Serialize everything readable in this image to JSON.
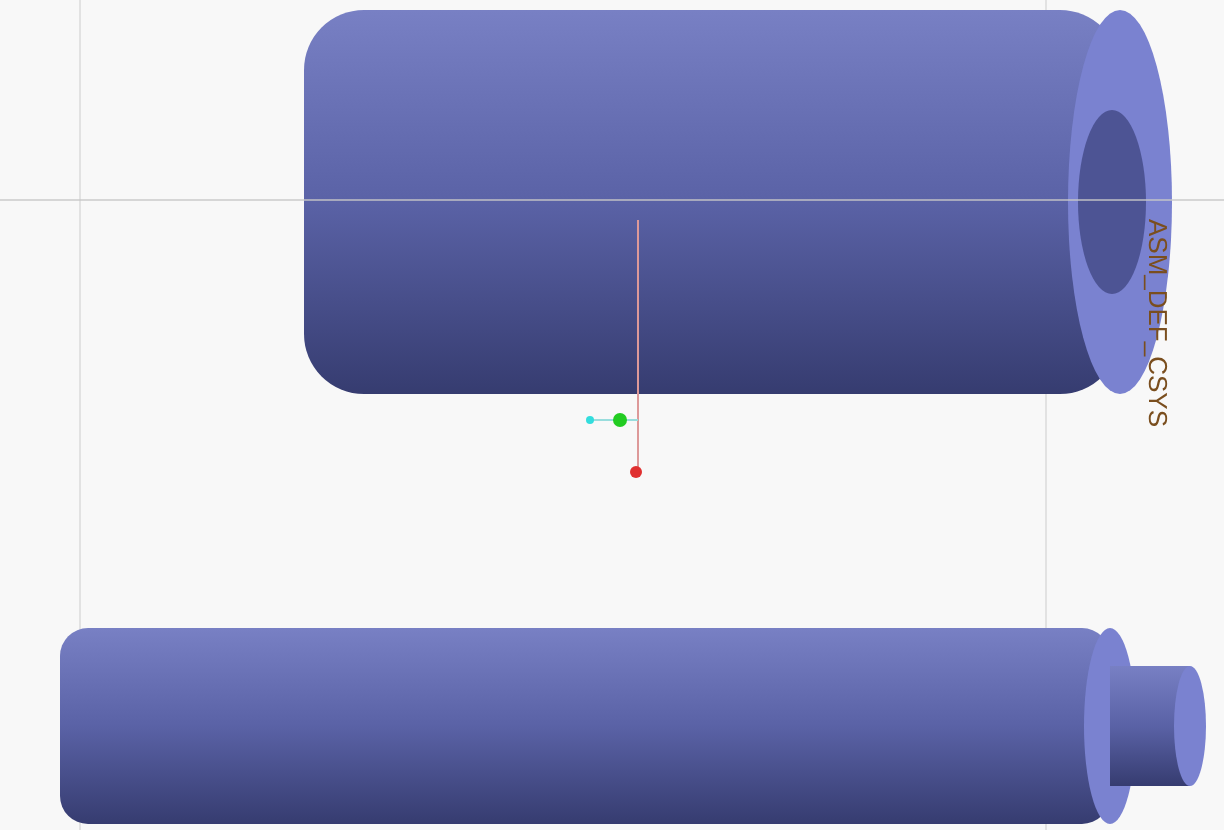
{
  "viewport": {
    "csys_label": "ASM_DEF_CSYS"
  }
}
